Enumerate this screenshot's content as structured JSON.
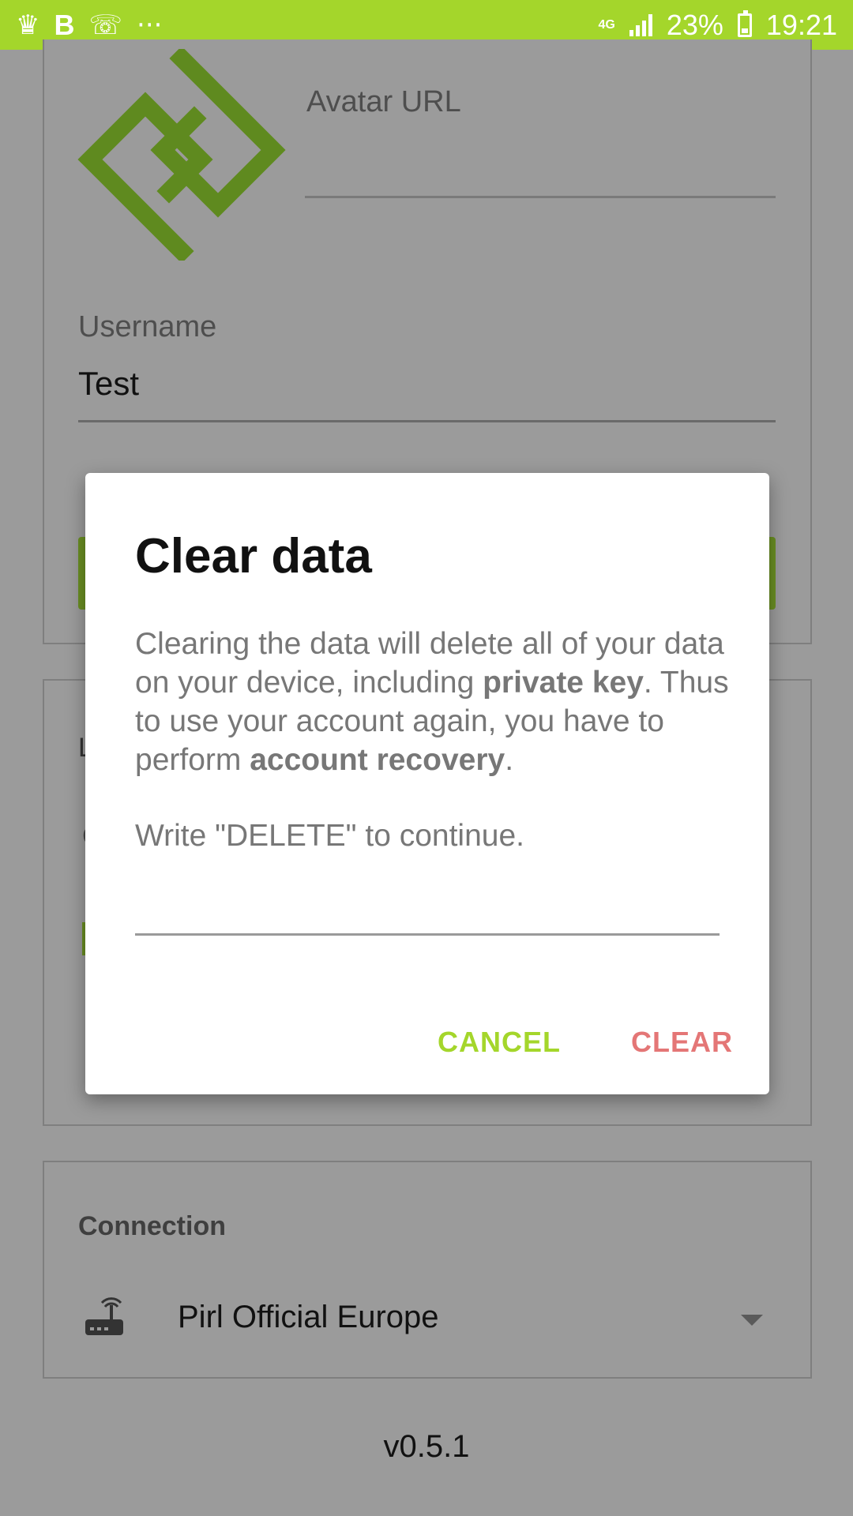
{
  "status_bar": {
    "battery": "23%",
    "time": "19:21",
    "network": "4G",
    "icons": [
      "crown-icon",
      "b-icon",
      "missed-call-icon",
      "more-icon",
      "signal-icon",
      "battery-icon"
    ],
    "background_color": "#a4d62b"
  },
  "profile": {
    "avatar_url_label": "Avatar URL",
    "username_label": "Username",
    "username_value": "Test"
  },
  "background_fragments": {
    "letter_1": "L",
    "letter_2": "C"
  },
  "connection": {
    "label": "Connection",
    "network_name": "Pirl Official Europe"
  },
  "version": "v0.5.1",
  "dialog": {
    "title": "Clear data",
    "body_parts": {
      "p1": "Clearing the data will delete all of your data on your device, including ",
      "b1": "private key",
      "p2": ". Thus to use your account again, you have to perform ",
      "b2": "account recovery",
      "p3": "."
    },
    "prompt": "Write \"DELETE\" to continue.",
    "input_value": "",
    "cancel_label": "CANCEL",
    "clear_label": "CLEAR",
    "colors": {
      "cancel": "#a4d62b",
      "clear": "#e47676"
    }
  }
}
